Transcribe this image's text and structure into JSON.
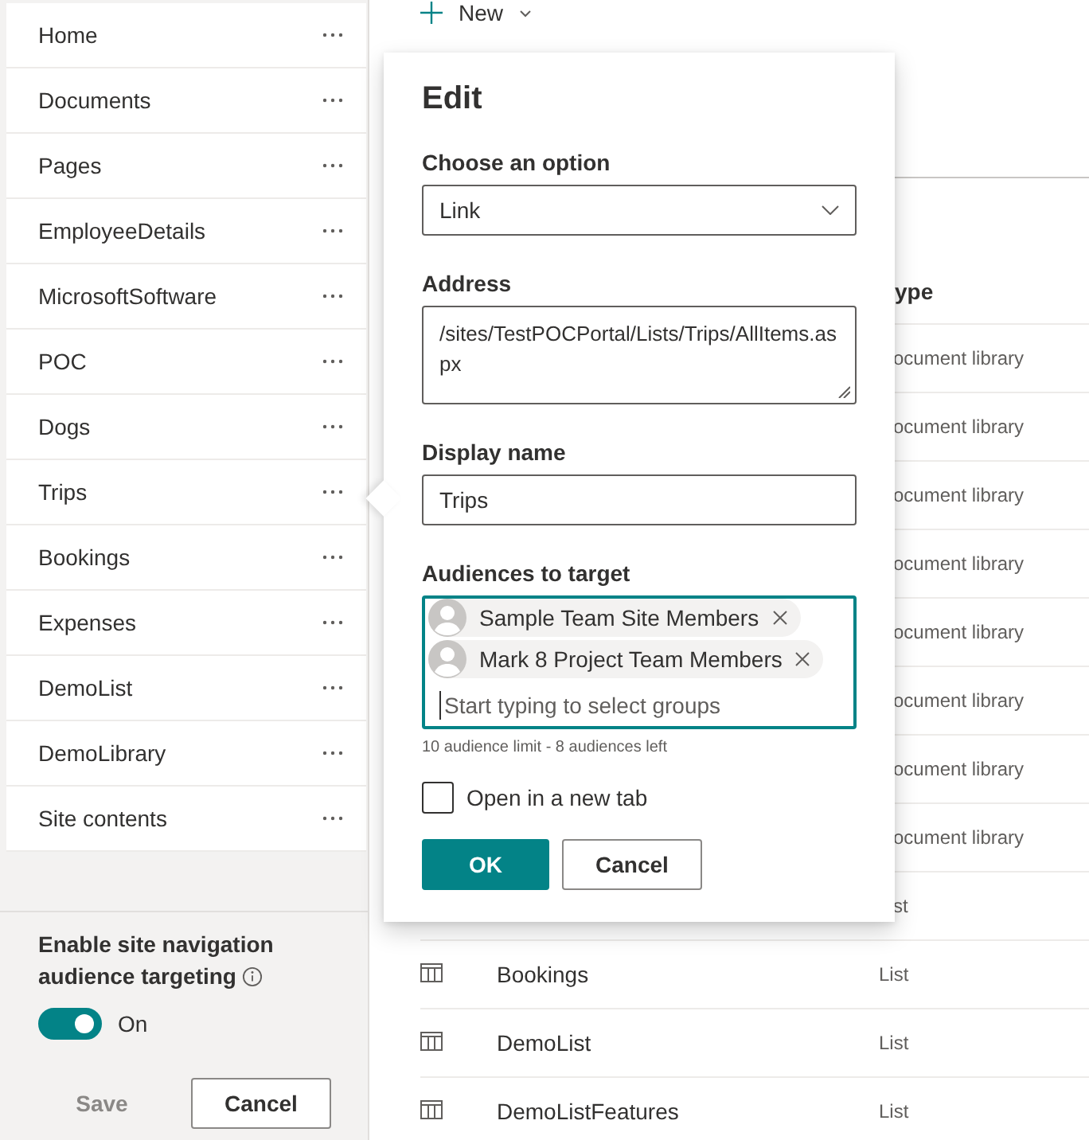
{
  "sidebar": {
    "nav_items": [
      "Home",
      "Documents",
      "Pages",
      "EmployeeDetails",
      "MicrosoftSoftware",
      "POC",
      "Dogs",
      "Trips",
      "Bookings",
      "Expenses",
      "DemoList",
      "DemoLibrary",
      "Site contents"
    ],
    "audience_targeting": {
      "label": "Enable site navigation audience targeting",
      "toggle": {
        "on": true,
        "label": "On"
      }
    },
    "buttons": [
      {
        "label": "Save",
        "disabled": true
      },
      {
        "label": "Cancel",
        "disabled": false
      }
    ]
  },
  "toolbar": {
    "new_label": "New"
  },
  "list": {
    "header": "ype",
    "rows": [
      {
        "type": "ocument library"
      },
      {
        "type": "ocument library"
      },
      {
        "type": "ocument library"
      },
      {
        "type": "ocument library"
      },
      {
        "type": "ocument library"
      },
      {
        "type": "ocument library"
      },
      {
        "type": "ocument library"
      },
      {
        "type": "ocument library"
      },
      {
        "type": "st"
      },
      {
        "name": "Bookings",
        "type": "List"
      },
      {
        "name": "DemoList",
        "type": "List"
      },
      {
        "name": "DemoListFeatures",
        "type": "List"
      }
    ]
  },
  "dialog": {
    "title": "Edit",
    "option_label": "Choose an option",
    "option_value": "Link",
    "address_label": "Address",
    "address_value": "/sites/TestPOCPortal/Lists/Trips/AllItems.aspx",
    "display_name_label": "Display name",
    "display_name_value": "Trips",
    "audiences_label": "Audiences to target",
    "audiences": [
      "Sample Team Site Members",
      "Mark 8 Project Team Members"
    ],
    "audiences_placeholder": "Start typing to select groups",
    "audiences_hint": "10 audience limit - 8 audiences left",
    "new_tab": {
      "label": "Open in a new tab",
      "checked": false
    },
    "buttons": [
      {
        "label": "OK",
        "primary": true
      },
      {
        "label": "Cancel",
        "primary": false
      }
    ]
  }
}
